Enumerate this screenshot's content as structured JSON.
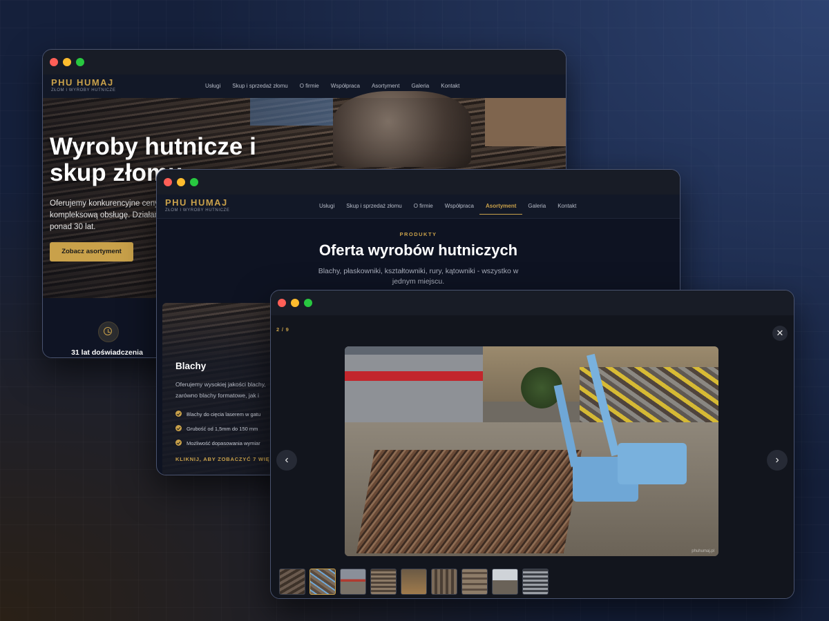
{
  "colors": {
    "accent": "#c9a14a",
    "bg": "#0e1322"
  },
  "site": {
    "logo_main": "PHU HUMAJ",
    "logo_sub": "ZŁOM I WYROBY HUTNICZE",
    "menu": [
      "Usługi",
      "Skup i sprzedaż złomu",
      "O firmie",
      "Współpraca",
      "Asortyment",
      "Galeria",
      "Kontakt"
    ],
    "active_menu": "Asortyment"
  },
  "home": {
    "hero_title": "Wyroby hutnicze i skup złomu",
    "hero_text": "Oferujemy konkurencyjne ceny i kompleksową obsługę. Działamy od ponad 30 lat.",
    "cta": "Zobacz asortyment",
    "stat_label": "31 lat doświadczenia",
    "stat_icon": "clock-icon"
  },
  "products": {
    "eyebrow": "PRODUKTY",
    "title": "Oferta wyrobów hutniczych",
    "subtitle": "Blachy, płaskowniki, kształtowniki, rury, kątowniki - wszystko w jednym miejscu.",
    "card": {
      "title": "Blachy",
      "desc": "Oferujemy wysokiej jakości blachy, zarówno blachy formatowe, jak i",
      "bullets": [
        "Blachy do cięcia laserem w gatu",
        "Grubość od 1,5mm do 150 mm",
        "Możliwość dopasowania wymiar"
      ],
      "more": "KLIKNIJ, ABY ZOBACZYĆ 7 WIĘCEJ"
    }
  },
  "lightbox": {
    "counter": "2 / 9",
    "close_icon": "close-icon",
    "prev_icon": "chevron-left-icon",
    "next_icon": "chevron-right-icon",
    "watermark": "phuhumaj.pl",
    "thumbnails_count": 9,
    "active_thumbnail": 2
  }
}
